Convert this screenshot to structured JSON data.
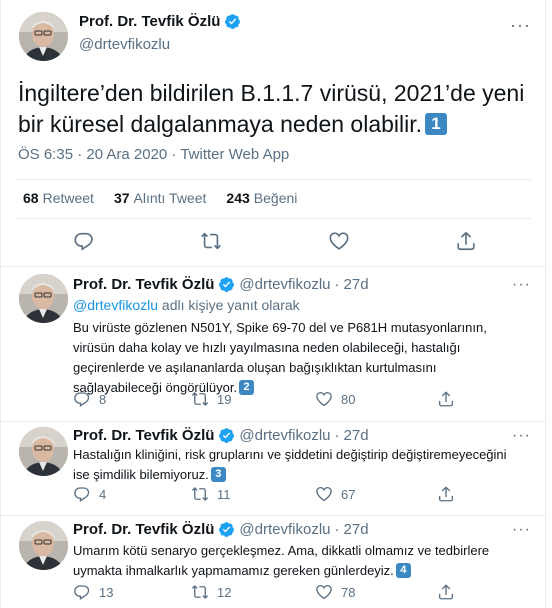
{
  "main_tweet": {
    "author_name": "Prof. Dr. Tevfik Özlü",
    "handle": "@drtevfikozlu",
    "text": "İngiltere’den bildirilen B.1.1.7 virüsü, 2021’de yeni bir küresel dalgalanmaya neden olabilir.",
    "keycap": "1",
    "timestamp": "ÖS 6:35 · 20 Ara 2020 · Twitter Web App",
    "stats": {
      "retweets_count": "68",
      "retweets_label": "Retweet",
      "quotes_count": "37",
      "quotes_label": "Alıntı Tweet",
      "likes_count": "243",
      "likes_label": "Beğeni"
    }
  },
  "replies": [
    {
      "author_name": "Prof. Dr. Tevfik Özlü",
      "handle": "@drtevfikozlu",
      "time": "27d",
      "reply_to_mention": "@drtevfikozlu",
      "reply_to_suffix": " adlı kişiye yanıt olarak",
      "text": "Bu virüste gözlenen N501Y, Spike 69-70 del ve P681H mutasyonlarının, virüsün daha kolay ve hızlı yayılmasına neden olabileceği, hastalığı geçirenlerde ve aşılananlarda oluşan bağışıklıktan kurtulmasını sağlayabileceği öngörülüyor.",
      "keycap": "2",
      "replies": "8",
      "retweets": "19",
      "likes": "80"
    },
    {
      "author_name": "Prof. Dr. Tevfik Özlü",
      "handle": "@drtevfikozlu",
      "time": "27d",
      "text": "Hastalığın kliniğini, risk gruplarını ve şiddetini değiştirip değiştiremeyeceğini ise şimdilik bilemiyoruz.",
      "keycap": "3",
      "replies": "4",
      "retweets": "11",
      "likes": "67"
    },
    {
      "author_name": "Prof. Dr. Tevfik Özlü",
      "handle": "@drtevfikozlu",
      "time": "27d",
      "text": "Umarım kötü senaryo gerçekleşmez. Ama, dikkatli olmamız ve tedbirlere uymakta ihmalkarlık yapmamamız gereken günlerdeyiz.",
      "keycap": "4",
      "replies": "13",
      "retweets": "12",
      "likes": "78"
    }
  ],
  "colors": {
    "accent": "#1da1f2",
    "keycap": "#3b88c3",
    "muted": "#5b7083"
  }
}
